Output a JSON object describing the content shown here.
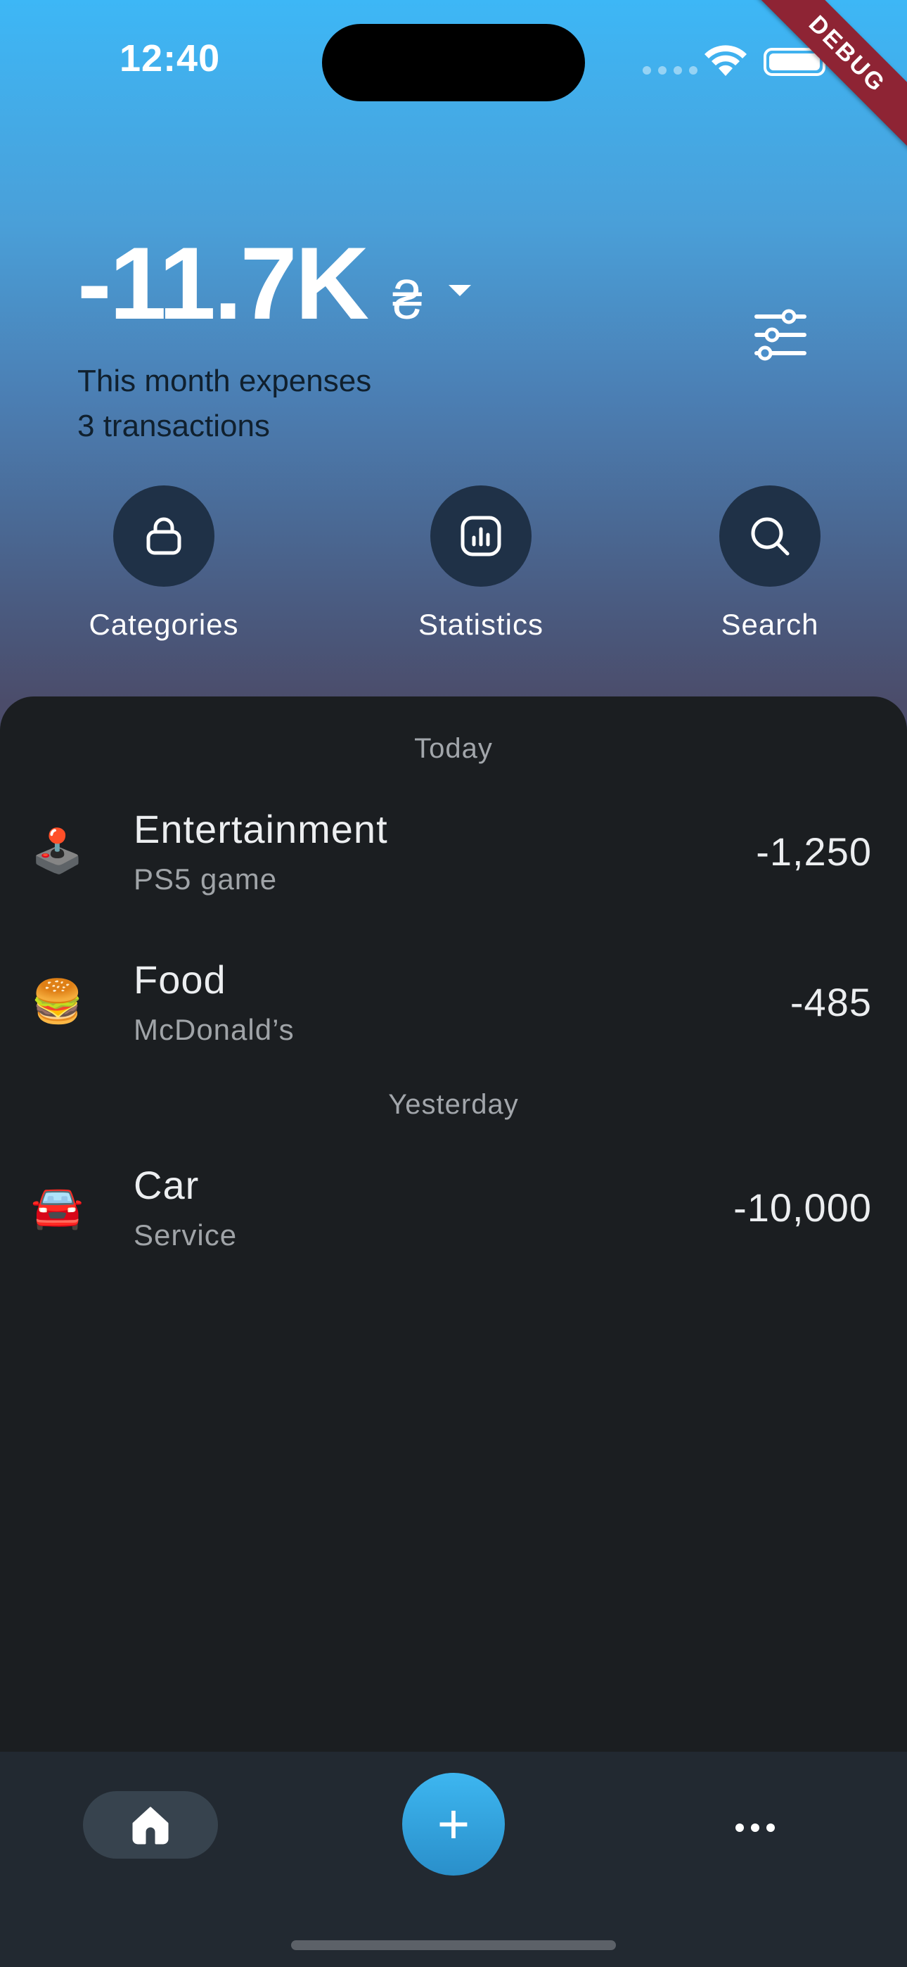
{
  "status_bar": {
    "time": "12:40"
  },
  "debug_banner": "DEBUG",
  "summary": {
    "amount": "-11.7K",
    "currency": "₴",
    "period_label": "This month expenses",
    "count_label": "3 transactions"
  },
  "actions": [
    {
      "label": "Categories",
      "icon": "bag-icon"
    },
    {
      "label": "Statistics",
      "icon": "chart-icon"
    },
    {
      "label": "Search",
      "icon": "search-icon"
    }
  ],
  "sections": [
    {
      "title": "Today",
      "transactions": [
        {
          "emoji": "🕹️",
          "category": "Entertainment",
          "note": "PS5 game",
          "amount": "-1,250"
        },
        {
          "emoji": "🍔",
          "category": "Food",
          "note": "McDonald’s",
          "amount": "-485"
        }
      ]
    },
    {
      "title": "Yesterday",
      "transactions": [
        {
          "emoji": "🚘",
          "category": "Car",
          "note": "Service",
          "amount": "-10,000"
        }
      ]
    }
  ],
  "bottom_nav": {
    "home_icon": "home-icon",
    "add_label": "+",
    "more_icon": "more-icon"
  },
  "colors": {
    "header_top": "#3db7f6",
    "accent": "#2e9fdb",
    "sheet_bg": "#1b1e21",
    "nav_bg": "#222931",
    "action_circle": "#1f3147",
    "debug_ribbon": "#8e2434"
  }
}
